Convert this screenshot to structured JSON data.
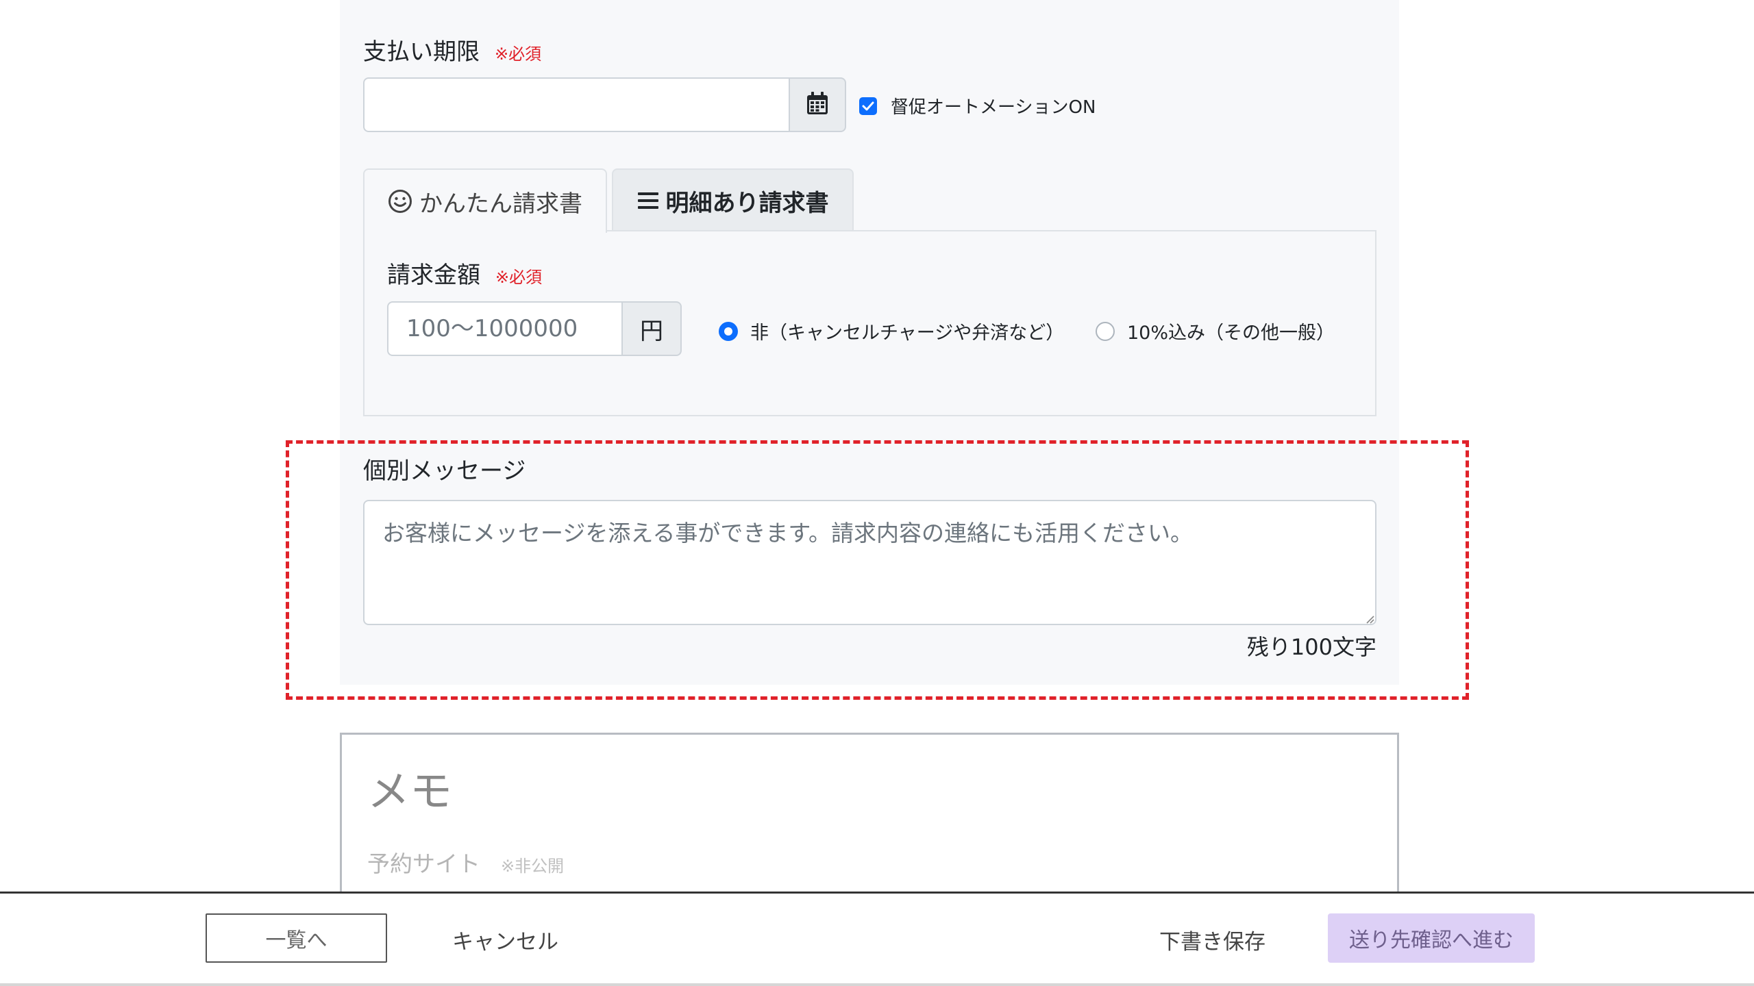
{
  "due_date": {
    "label": "支払い期限",
    "required": "※必須",
    "value": "",
    "auto_reminder_label": "督促オートメーションON",
    "auto_reminder_checked": true
  },
  "tabs": [
    {
      "label": "かんたん請求書",
      "icon": "smile-icon",
      "active": true
    },
    {
      "label": "明細あり請求書",
      "icon": "list-icon",
      "active": false
    }
  ],
  "amount": {
    "label": "請求金額",
    "required": "※必須",
    "placeholder": "100〜1000000",
    "unit": "円",
    "tax_options": [
      {
        "label": "非（キャンセルチャージや弁済など）",
        "selected": true
      },
      {
        "label": "10%込み（その他一般）",
        "selected": false
      }
    ]
  },
  "message": {
    "label": "個別メッセージ",
    "placeholder": "お客様にメッセージを添える事ができます。請求内容の連絡にも活用ください。",
    "remaining": "残り100文字"
  },
  "memo": {
    "title": "メモ",
    "field_label": "予約サイト",
    "field_note": "※非公開"
  },
  "footer": {
    "back_label": "一覧へ",
    "cancel_label": "キャンセル",
    "draft_label": "下書き保存",
    "next_label": "送り先確認へ進む"
  },
  "colors": {
    "primary": "#0d6efd",
    "required": "#e0222a",
    "next_button_bg": "#ddd0f6"
  }
}
